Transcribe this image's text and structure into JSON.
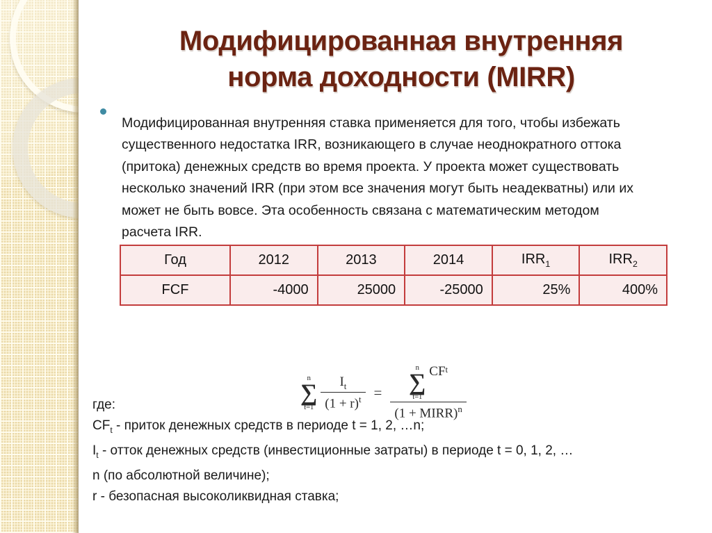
{
  "slide": {
    "title_lines": [
      "Модифицированная внутренняя",
      "норма доходности (MIRR)"
    ],
    "bullet_text": "Модифицированная внутренняя ставка применяется для того, чтобы избежать существенного  недостатка IRR, возникающего в случае неоднократного оттока (притока) денежных средств во время проекта. У проекта может существовать несколько значений IRR (при этом все значения могут быть неадекватны) или их может не быть вовсе. Эта особенность связана с математическим методом расчета IRR.",
    "where_label": "где:"
  },
  "table": {
    "header": [
      "Год",
      "2012",
      "2013",
      "2014",
      "IRR",
      "IRR"
    ],
    "header_subs": [
      "",
      "",
      "",
      "",
      "1",
      "2"
    ],
    "row_label": "FCF",
    "row_values": [
      "-4000",
      "25000",
      "-25000",
      "25%",
      "400%"
    ]
  },
  "formula": {
    "left_sum_upper": "n",
    "left_sum_lower": "t=1",
    "left_numerator": "I",
    "left_numerator_sub": "t",
    "left_denominator": "(1 + r)",
    "left_denominator_sup": "t",
    "equals": "=",
    "right_sum_upper": "n",
    "right_sum_lower": "t=1",
    "right_numerator": "CF",
    "right_numerator_sub": "t",
    "right_denominator": "(1 + MIRR)",
    "right_denominator_sup": "n"
  },
  "legend": {
    "cf_symbol": "CF",
    "cf_sub": "t",
    "cf_text": " - приток денежных средств в периоде t = 1, 2, …n;",
    "i_symbol": "I",
    "i_sub": "t",
    "i_text": " - отток денежных средств (инвестиционные затраты)  в периоде t = 0, 1, 2, …",
    "n_line": "n (по абсолютной величине);",
    "r_line": "r - безопасная высоколиквидная ставка;"
  },
  "colors": {
    "title": "#6b2312",
    "bullet": "#3f8ba3",
    "table_border": "#c33c3c",
    "table_fill": "#faecec",
    "sidebar": "#ead9a8"
  }
}
